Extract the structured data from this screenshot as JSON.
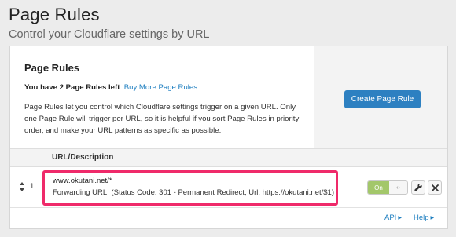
{
  "header": {
    "title": "Page Rules",
    "subtitle": "Control your Cloudflare settings by URL"
  },
  "card": {
    "heading": "Page Rules",
    "quota_strong": "You have 2 Page Rules left",
    "quota_period": ".",
    "buy_link": "Buy More Page Rules.",
    "description": "Page Rules let you control which Cloudflare settings trigger on a given URL. Only one Page Rule will trigger per URL, so it is helpful if you sort Page Rules in priority order, and make your URL patterns as specific as possible.",
    "create_button": "Create Page Rule"
  },
  "table": {
    "column_header": "URL/Description",
    "rows": [
      {
        "index": "1",
        "url": "www.okutani.net/*",
        "description": "Forwarding URL: (Status Code: 301 - Permanent Redirect, Url: https://okutani.net/$1)",
        "toggle_label": "On",
        "toggle_knob": "‹›"
      }
    ]
  },
  "footer": {
    "api_link": "API",
    "help_link": "Help"
  },
  "icons": {
    "drag": "drag-handle-icon",
    "edit": "wrench-icon",
    "delete": "close-icon"
  },
  "colors": {
    "accent": "#2d80c1",
    "link": "#1f7fc0",
    "toggle_on": "#a3c76a",
    "highlight": "#ef2a6a"
  }
}
